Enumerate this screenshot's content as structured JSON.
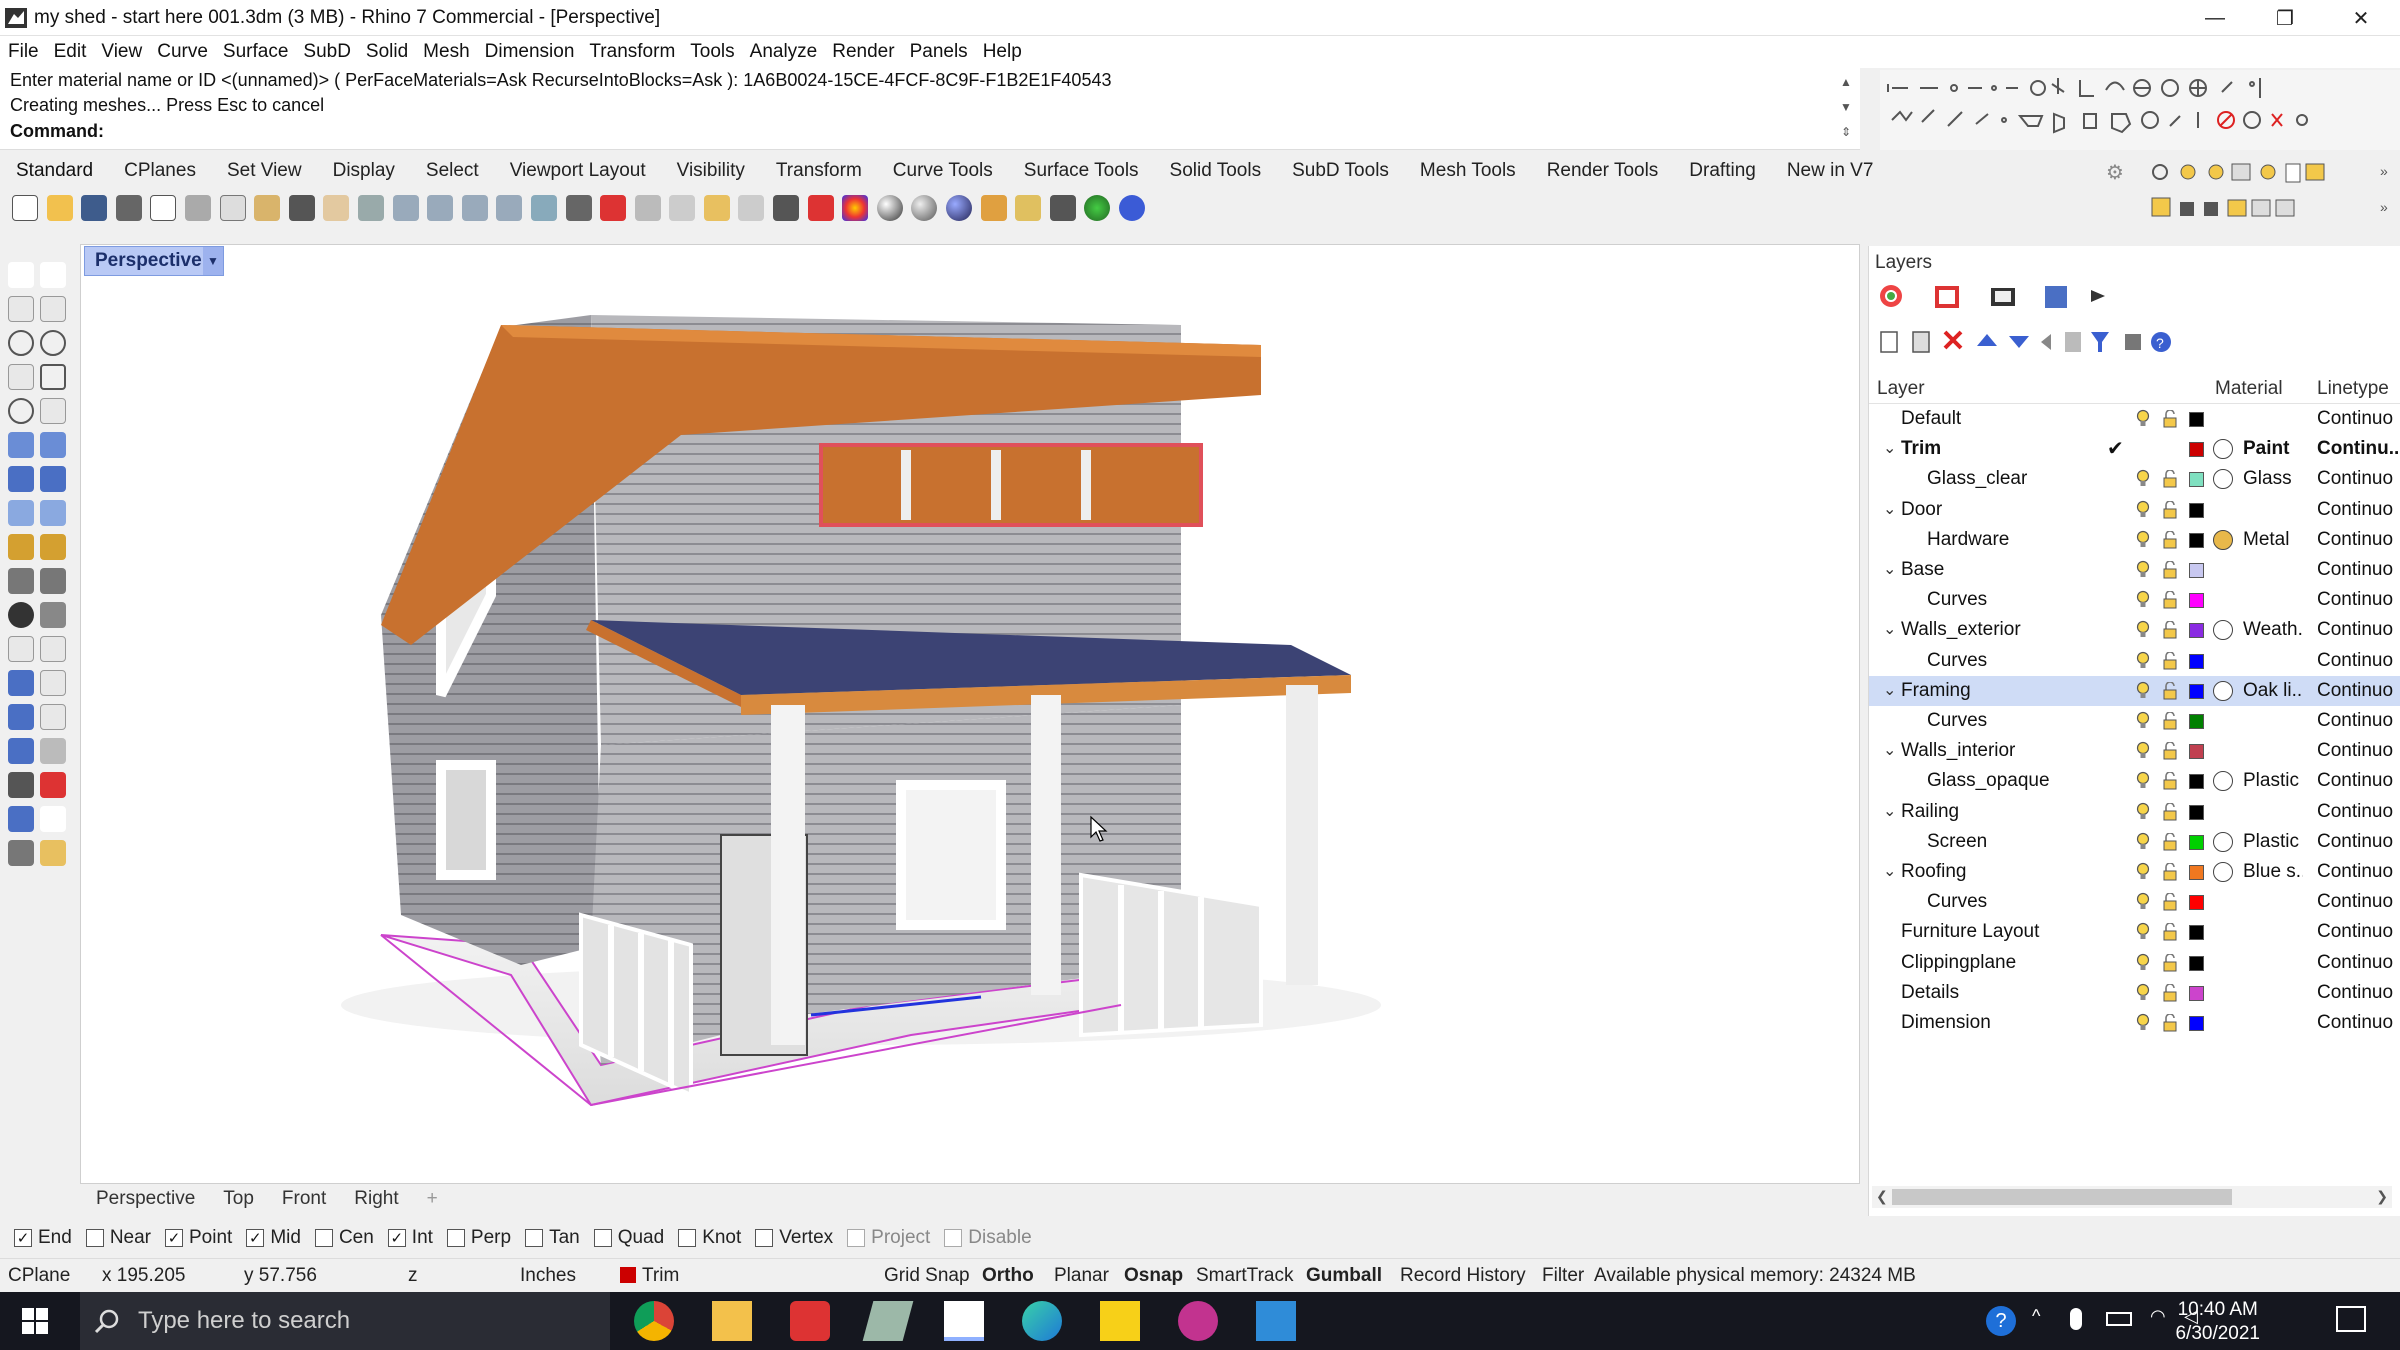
{
  "window": {
    "title": "my shed - start here 001.3dm (3 MB) - Rhino 7 Commercial - [Perspective]",
    "minimize": "—",
    "maximize": "❐",
    "close": "✕"
  },
  "menu": [
    "File",
    "Edit",
    "View",
    "Curve",
    "Surface",
    "SubD",
    "Solid",
    "Mesh",
    "Dimension",
    "Transform",
    "Tools",
    "Analyze",
    "Render",
    "Panels",
    "Help"
  ],
  "command": {
    "line1": "Enter material name or ID <(unnamed)> ( PerFaceMaterials=Ask  RecurseIntoBlocks=Ask ): 1A6B0024-15CE-4FCF-8C9F-F1B2E1F40543",
    "line2": "Creating meshes... Press Esc to cancel",
    "prompt": "Command:"
  },
  "toolbar_tabs": [
    "Standard",
    "CPlanes",
    "Set View",
    "Display",
    "Select",
    "Viewport Layout",
    "Visibility",
    "Transform",
    "Curve Tools",
    "Surface Tools",
    "Solid Tools",
    "SubD Tools",
    "Mesh Tools",
    "Render Tools",
    "Drafting",
    "New in V7"
  ],
  "viewport": {
    "active_label": "Perspective",
    "tabs": [
      "Perspective",
      "Top",
      "Front",
      "Right"
    ],
    "add_tab": "+"
  },
  "osnap": [
    {
      "label": "End",
      "checked": true,
      "enabled": true
    },
    {
      "label": "Near",
      "checked": false,
      "enabled": true
    },
    {
      "label": "Point",
      "checked": true,
      "enabled": true
    },
    {
      "label": "Mid",
      "checked": true,
      "enabled": true
    },
    {
      "label": "Cen",
      "checked": false,
      "enabled": true
    },
    {
      "label": "Int",
      "checked": true,
      "enabled": true
    },
    {
      "label": "Perp",
      "checked": false,
      "enabled": true
    },
    {
      "label": "Tan",
      "checked": false,
      "enabled": true
    },
    {
      "label": "Quad",
      "checked": false,
      "enabled": true
    },
    {
      "label": "Knot",
      "checked": false,
      "enabled": true
    },
    {
      "label": "Vertex",
      "checked": false,
      "enabled": true
    },
    {
      "label": "Project",
      "checked": false,
      "enabled": false
    },
    {
      "label": "Disable",
      "checked": false,
      "enabled": false
    }
  ],
  "status": {
    "cplane": "CPlane",
    "x": "x 195.205",
    "y": "y 57.756",
    "z": "z",
    "units": "Inches",
    "layer": "Trim",
    "layer_color": "#cc0000",
    "grid_snap": "Grid Snap",
    "ortho": "Ortho",
    "planar": "Planar",
    "osnap": "Osnap",
    "smarttrack": "SmartTrack",
    "gumball": "Gumball",
    "record_history": "Record History",
    "filter": "Filter",
    "memory": "Available physical memory: 24324 MB"
  },
  "layers_panel": {
    "title": "Layers",
    "columns": {
      "layer": "Layer",
      "material": "Material",
      "linetype": "Linetype"
    },
    "rows": [
      {
        "name": "Default",
        "indent": 0,
        "expand": "",
        "bold": false,
        "current": false,
        "color": "#000000",
        "material": "",
        "mat_swatch": "",
        "linetype": "Continuo",
        "selected": false
      },
      {
        "name": "Trim",
        "indent": 0,
        "expand": "⌄",
        "bold": true,
        "current": true,
        "color": "#cc0000",
        "material": "Paint",
        "mat_swatch": "#ffffff",
        "linetype": "Continu...",
        "selected": false
      },
      {
        "name": "Glass_clear",
        "indent": 1,
        "expand": "",
        "bold": false,
        "current": false,
        "color": "#7fe0c0",
        "material": "Glass",
        "mat_swatch": "#ffffff",
        "linetype": "Continuo",
        "selected": false
      },
      {
        "name": "Door",
        "indent": 0,
        "expand": "⌄",
        "bold": false,
        "current": false,
        "color": "#000000",
        "material": "",
        "mat_swatch": "",
        "linetype": "Continuo",
        "selected": false
      },
      {
        "name": "Hardware",
        "indent": 1,
        "expand": "",
        "bold": false,
        "current": false,
        "color": "#000000",
        "material": "Metal",
        "mat_swatch": "#e8b84a",
        "linetype": "Continuo",
        "selected": false
      },
      {
        "name": "Base",
        "indent": 0,
        "expand": "⌄",
        "bold": false,
        "current": false,
        "color": "#c8c8f0",
        "material": "",
        "mat_swatch": "",
        "linetype": "Continuo",
        "selected": false
      },
      {
        "name": "Curves",
        "indent": 1,
        "expand": "",
        "bold": false,
        "current": false,
        "color": "#ff00ff",
        "material": "",
        "mat_swatch": "",
        "linetype": "Continuo",
        "selected": false
      },
      {
        "name": "Walls_exterior",
        "indent": 0,
        "expand": "⌄",
        "bold": false,
        "current": false,
        "color": "#8a2be2",
        "material": "Weath...",
        "mat_swatch": "#ffffff",
        "linetype": "Continuo",
        "selected": false
      },
      {
        "name": "Curves",
        "indent": 1,
        "expand": "",
        "bold": false,
        "current": false,
        "color": "#0000ff",
        "material": "",
        "mat_swatch": "",
        "linetype": "Continuo",
        "selected": false
      },
      {
        "name": "Framing",
        "indent": 0,
        "expand": "⌄",
        "bold": false,
        "current": false,
        "color": "#0000ff",
        "material": "Oak li...",
        "mat_swatch": "#ffffff",
        "linetype": "Continuo",
        "selected": true
      },
      {
        "name": "Curves",
        "indent": 1,
        "expand": "",
        "bold": false,
        "current": false,
        "color": "#008000",
        "material": "",
        "mat_swatch": "",
        "linetype": "Continuo",
        "selected": false
      },
      {
        "name": "Walls_interior",
        "indent": 0,
        "expand": "⌄",
        "bold": false,
        "current": false,
        "color": "#c04050",
        "material": "",
        "mat_swatch": "",
        "linetype": "Continuo",
        "selected": false
      },
      {
        "name": "Glass_opaque",
        "indent": 1,
        "expand": "",
        "bold": false,
        "current": false,
        "color": "#000000",
        "material": "Plastic",
        "mat_swatch": "#ffffff",
        "linetype": "Continuo",
        "selected": false
      },
      {
        "name": "Railing",
        "indent": 0,
        "expand": "⌄",
        "bold": false,
        "current": false,
        "color": "#000000",
        "material": "",
        "mat_swatch": "",
        "linetype": "Continuo",
        "selected": false
      },
      {
        "name": "Screen",
        "indent": 1,
        "expand": "",
        "bold": false,
        "current": false,
        "color": "#00d000",
        "material": "Plastic",
        "mat_swatch": "#ffffff",
        "linetype": "Continuo",
        "selected": false
      },
      {
        "name": "Roofing",
        "indent": 0,
        "expand": "⌄",
        "bold": false,
        "current": false,
        "color": "#f07820",
        "material": "Blue s...",
        "mat_swatch": "#ffffff",
        "linetype": "Continuo",
        "selected": false
      },
      {
        "name": "Curves",
        "indent": 1,
        "expand": "",
        "bold": false,
        "current": false,
        "color": "#ff0000",
        "material": "",
        "mat_swatch": "",
        "linetype": "Continuo",
        "selected": false
      },
      {
        "name": "Furniture Layout",
        "indent": 0,
        "expand": "",
        "bold": false,
        "current": false,
        "color": "#000000",
        "material": "",
        "mat_swatch": "",
        "linetype": "Continuo",
        "selected": false
      },
      {
        "name": "Clippingplane",
        "indent": 0,
        "expand": "",
        "bold": false,
        "current": false,
        "color": "#000000",
        "material": "",
        "mat_swatch": "",
        "linetype": "Continuo",
        "selected": false
      },
      {
        "name": "Details",
        "indent": 0,
        "expand": "",
        "bold": false,
        "current": false,
        "color": "#cc44cc",
        "material": "",
        "mat_swatch": "",
        "linetype": "Continuo",
        "selected": false
      },
      {
        "name": "Dimension",
        "indent": 0,
        "expand": "",
        "bold": false,
        "current": false,
        "color": "#0000ff",
        "material": "",
        "mat_swatch": "",
        "linetype": "Continuo",
        "selected": false
      }
    ]
  },
  "taskbar": {
    "search_placeholder": "Type here to search",
    "time": "10:40 AM",
    "date": "6/30/2021"
  },
  "colors": {
    "viewport_label_bg": "#b9c9f5",
    "selected_layer_bg": "#cfdcf6",
    "taskbar": "#15171f"
  }
}
